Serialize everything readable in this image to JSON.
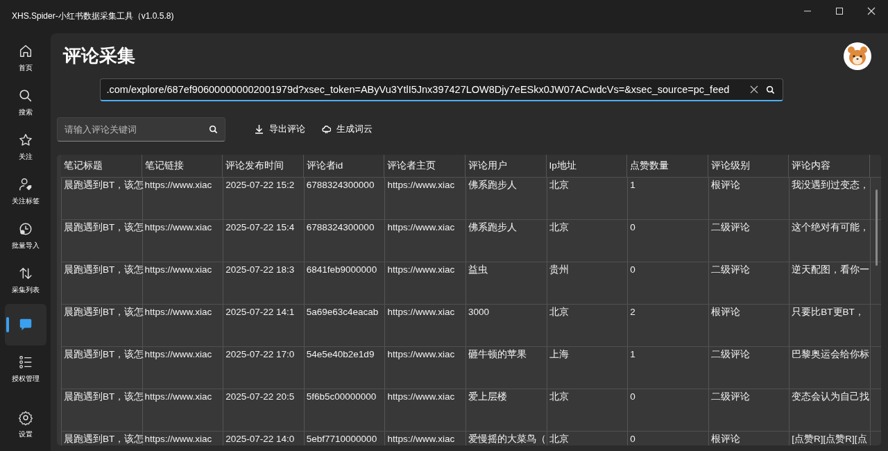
{
  "window": {
    "title": "XHS.Spider-小红书数据采集工具（v1.0.5.8)"
  },
  "sidebar": {
    "items": [
      {
        "label": "首页",
        "selected": false
      },
      {
        "label": "搜索",
        "selected": false
      },
      {
        "label": "关注",
        "selected": false
      },
      {
        "label": "关注标签",
        "selected": false
      },
      {
        "label": "批量导入",
        "selected": false
      },
      {
        "label": "采集列表",
        "selected": false
      },
      {
        "selected": true
      },
      {
        "label": "授权管理",
        "selected": false
      }
    ],
    "footer_item": {
      "label": "设置",
      "selected": false
    }
  },
  "page": {
    "title": "评论采集"
  },
  "url_field": {
    "value": ".com/explore/687ef906000000002001979d?xsec_token=AByVu3YtlI5Jnx397427LOW8Djy7eESkx0JW07ACwdcVs=&xsec_source=pc_feed"
  },
  "keyword_search": {
    "placeholder": "请输入评论关键词"
  },
  "actions": [
    "导出评论",
    "生成词云"
  ],
  "table": {
    "columns": [
      "笔记标题",
      "笔记链接",
      "评论发布时间",
      "评论者id",
      "评论者主页",
      "评论用户",
      "Ip地址",
      "点赞数量",
      "评论级别",
      "评论内容"
    ],
    "rows": [
      [
        "晨跑遇到BT，该怎",
        "https://www.xiac",
        "2025-07-22 15:2",
        "6788324300000",
        "https://www.xiac",
        "佛系跑步人",
        "北京",
        "1",
        "根评论",
        "我没遇到过变态，"
      ],
      [
        "晨跑遇到BT，该怎",
        "https://www.xiac",
        "2025-07-22 15:4",
        "6788324300000",
        "https://www.xiac",
        "佛系跑步人",
        "北京",
        "0",
        "二级评论",
        "这个绝对有可能，"
      ],
      [
        "晨跑遇到BT，该怎",
        "https://www.xiac",
        "2025-07-22 18:3",
        "6841feb9000000",
        "https://www.xiac",
        "益虫",
        "贵州",
        "0",
        "二级评论",
        "逆天配图，看你一"
      ],
      [
        "晨跑遇到BT，该怎",
        "https://www.xiac",
        "2025-07-22 14:1",
        "5a69e63c4eacab",
        "https://www.xiac",
        "3000",
        "北京",
        "2",
        "根评论",
        "只要比BT更BT，"
      ],
      [
        "晨跑遇到BT，该怎",
        "https://www.xiac",
        "2025-07-22 17:0",
        "54e5e40b2e1d9",
        "https://www.xiac",
        "砸牛顿的苹果",
        "上海",
        "1",
        "二级评论",
        "巴黎奥运会给你标"
      ],
      [
        "晨跑遇到BT，该怎",
        "https://www.xiac",
        "2025-07-22 20:5",
        "5f6b5c00000000",
        "https://www.xiac",
        "爱上层楼",
        "北京",
        "0",
        "二级评论",
        "变态会认为自己找"
      ],
      [
        "晨跑遇到BT，该怎",
        "https://www.xiac",
        "2025-07-22 14:0",
        "5ebf7710000000",
        "https://www.xiac",
        "爱慢摇的大菜鸟（",
        "北京",
        "0",
        "根评论",
        "[点赞R][点赞R][点"
      ]
    ]
  }
}
